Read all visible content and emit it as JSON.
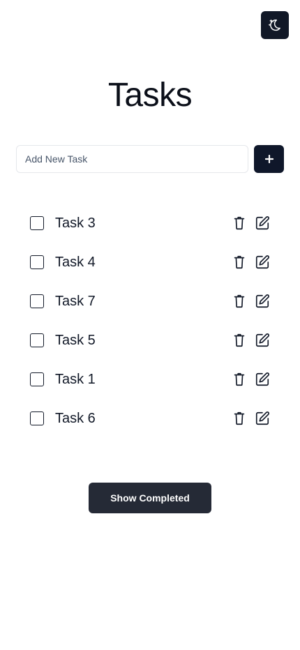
{
  "header": {
    "theme_toggle_icon": "moon-stars-icon",
    "title": "Tasks"
  },
  "add_task": {
    "value": "",
    "placeholder": "Add New Task",
    "button_icon": "plus-icon"
  },
  "tasks": [
    {
      "label": "Task 3",
      "completed": false
    },
    {
      "label": "Task 4",
      "completed": false
    },
    {
      "label": "Task 7",
      "completed": false
    },
    {
      "label": "Task 5",
      "completed": false
    },
    {
      "label": "Task 1",
      "completed": false
    },
    {
      "label": "Task 6",
      "completed": false
    }
  ],
  "task_actions": {
    "delete_icon": "trash-icon",
    "edit_icon": "edit-square-icon"
  },
  "footer": {
    "show_completed_label": "Show Completed"
  },
  "colors": {
    "accent_dark": "#0f172a",
    "button_dark": "#252a36",
    "text": "#111827",
    "border": "#e5e7eb"
  }
}
